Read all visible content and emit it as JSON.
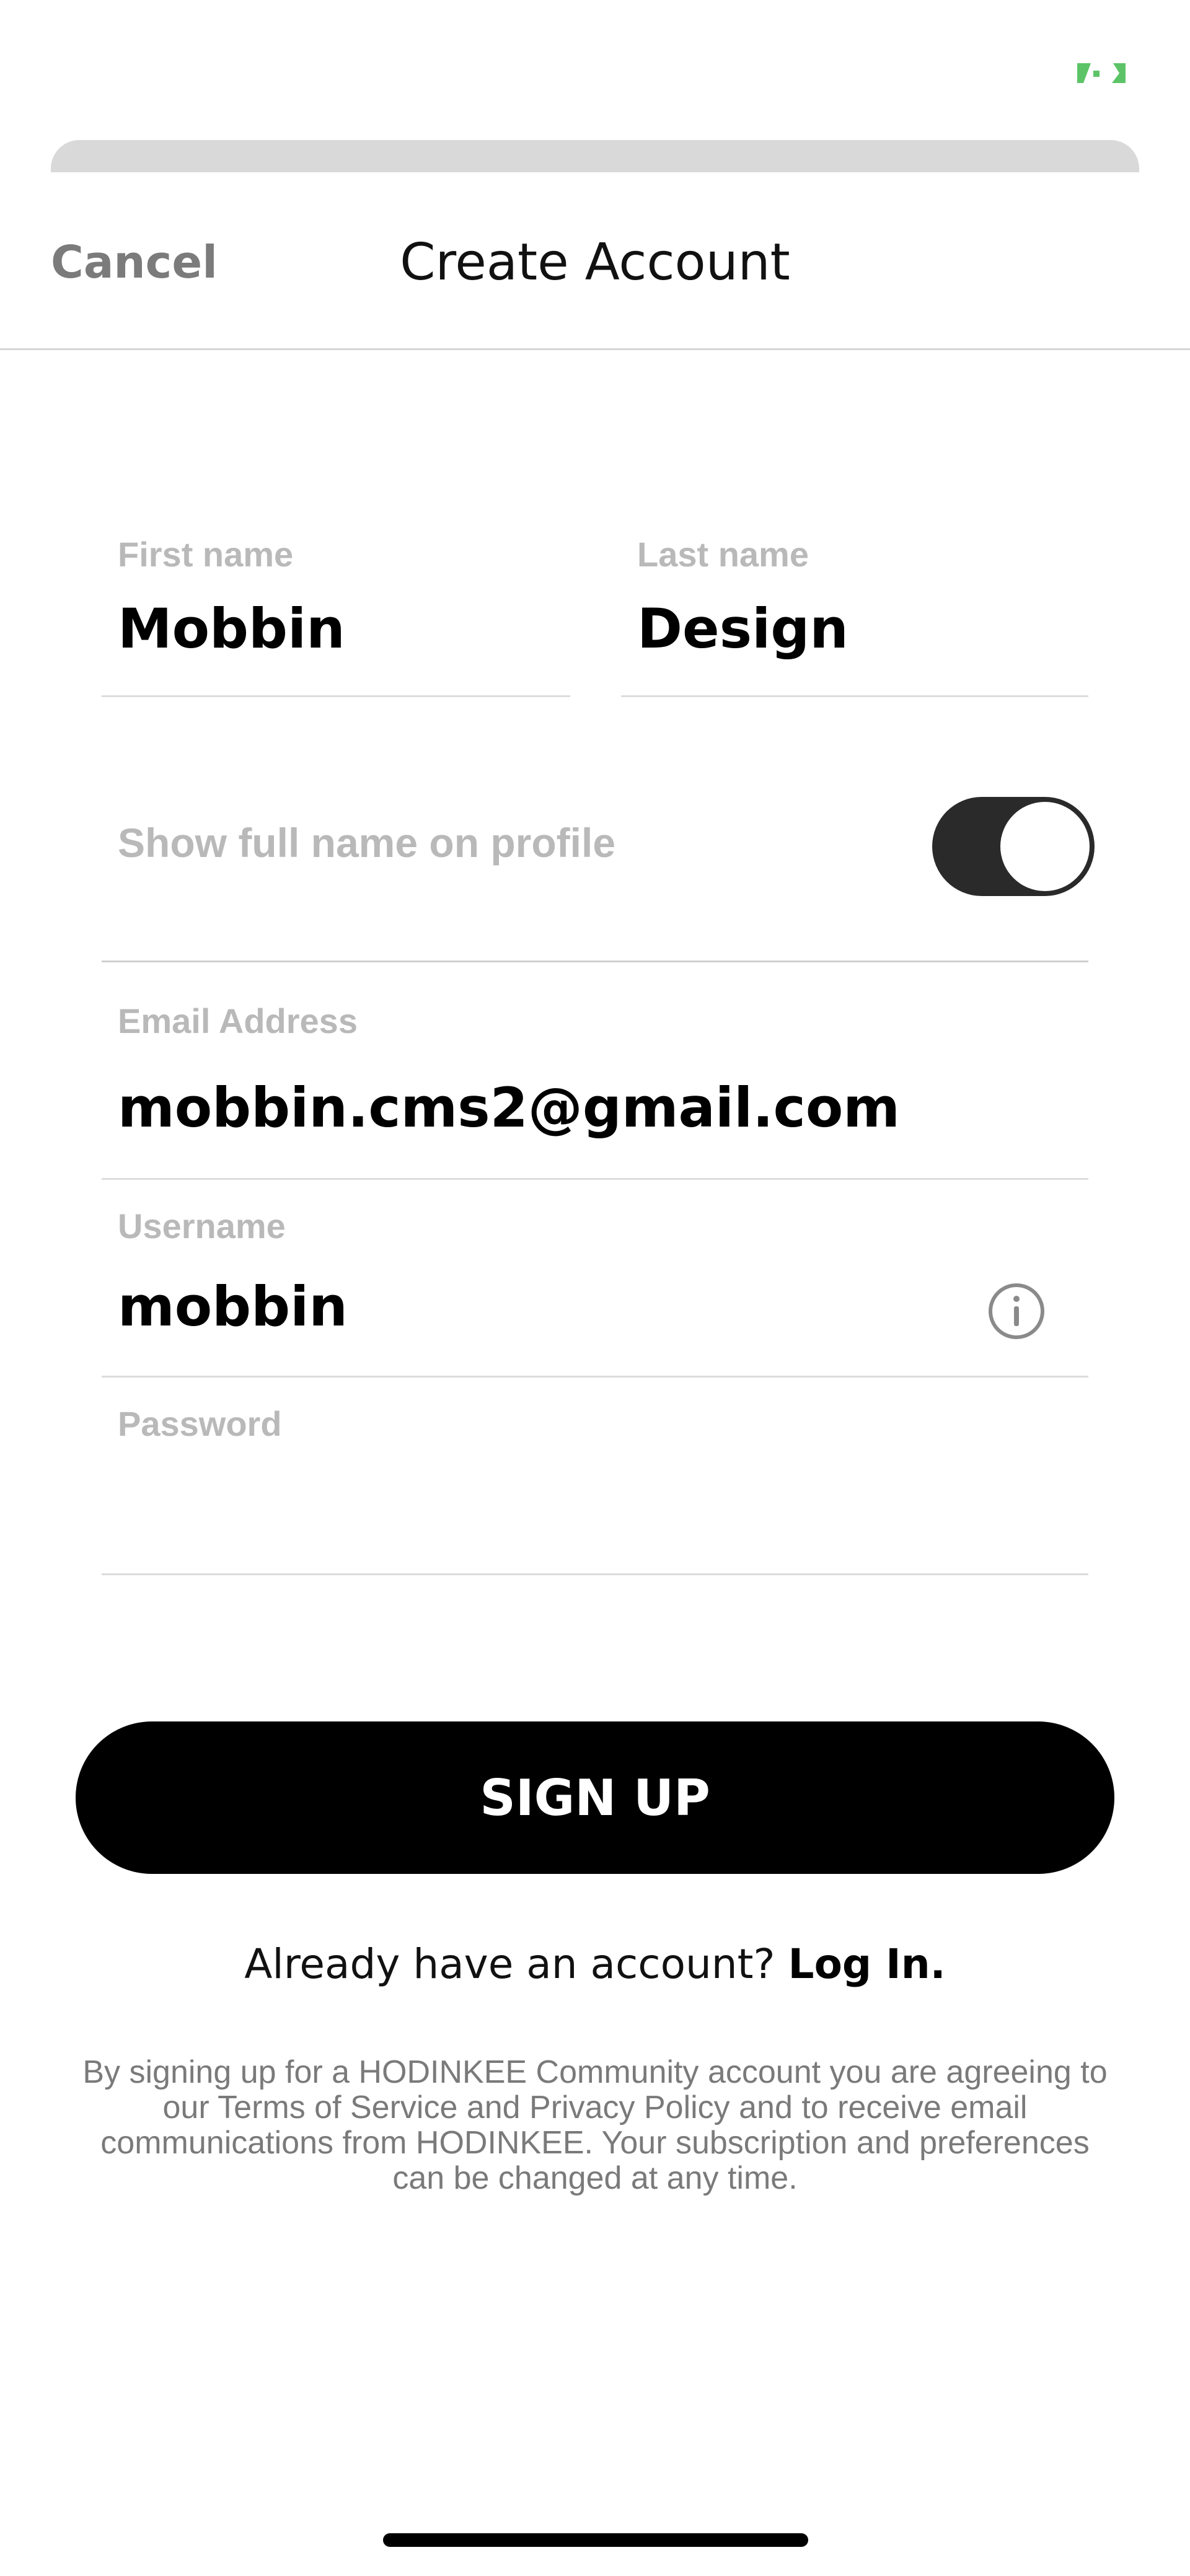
{
  "status_bar": {
    "battery_color": "#5cc466",
    "icon": "battery-charging-icon"
  },
  "header": {
    "cancel_label": "Cancel",
    "title": "Create Account"
  },
  "form": {
    "first_name": {
      "label": "First name",
      "value": "Mobbin"
    },
    "last_name": {
      "label": "Last name",
      "value": "Design"
    },
    "show_full_name": {
      "label": "Show full name on profile",
      "enabled": true
    },
    "email": {
      "label": "Email Address",
      "value": "mobbin.cms2@gmail.com"
    },
    "username": {
      "label": "Username",
      "value": "mobbin",
      "icon": "info-icon"
    },
    "password": {
      "label": "Password",
      "value": ""
    }
  },
  "actions": {
    "signup_label": "SIGN UP",
    "login_prompt": "Already have an account?",
    "login_link": "Log In."
  },
  "legal": {
    "text": "By signing up for a HODINKEE Community account you are agreeing to our Terms of Service and Privacy Policy and to receive email communications from HODINKEE. Your subscription and preferences can be changed at any time."
  },
  "colors": {
    "primary": "#000000",
    "toggle_on": "#2a2a2a",
    "label_gray": "#b9b9b9",
    "cancel_gray": "#7b7b7b"
  }
}
